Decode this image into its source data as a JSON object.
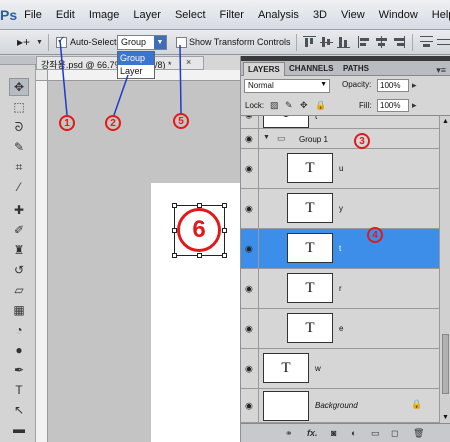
{
  "app": {
    "logo": "Ps"
  },
  "menu": [
    "File",
    "Edit",
    "Image",
    "Layer",
    "Select",
    "Filter",
    "Analysis",
    "3D",
    "View",
    "Window",
    "Help"
  ],
  "options": {
    "tool_glyph": "▸+",
    "auto_select_label": "Auto-Select:",
    "auto_select_value": "Group",
    "auto_select_options": [
      "Group",
      "Layer"
    ],
    "show_transform_label": "Show Transform Controls"
  },
  "document": {
    "tab_title": "강좌용.psd @ 66.7% (t, RGB/8) *"
  },
  "panel": {
    "tabs": [
      "LAYERS",
      "CHANNELS",
      "PATHS"
    ],
    "blend_mode": "Normal",
    "opacity_label": "Opacity:",
    "opacity_value": "100%",
    "lock_label": "Lock:",
    "fill_label": "Fill:",
    "fill_value": "100%"
  },
  "layers": [
    {
      "name": "t",
      "type": "text",
      "partial": true
    },
    {
      "name": "Group 1",
      "type": "group"
    },
    {
      "name": "u",
      "type": "text"
    },
    {
      "name": "y",
      "type": "text"
    },
    {
      "name": "t",
      "type": "text",
      "selected": true
    },
    {
      "name": "r",
      "type": "text"
    },
    {
      "name": "e",
      "type": "text"
    },
    {
      "name": "w",
      "type": "text"
    },
    {
      "name": "q",
      "type": "text"
    },
    {
      "name": "Background",
      "type": "background"
    }
  ],
  "annotations": [
    "1",
    "2",
    "3",
    "4",
    "5",
    "6"
  ],
  "colors": {
    "annotation": "#e01a1a",
    "selection": "#3d8ee8",
    "menu_highlight": "#3a75d2"
  }
}
